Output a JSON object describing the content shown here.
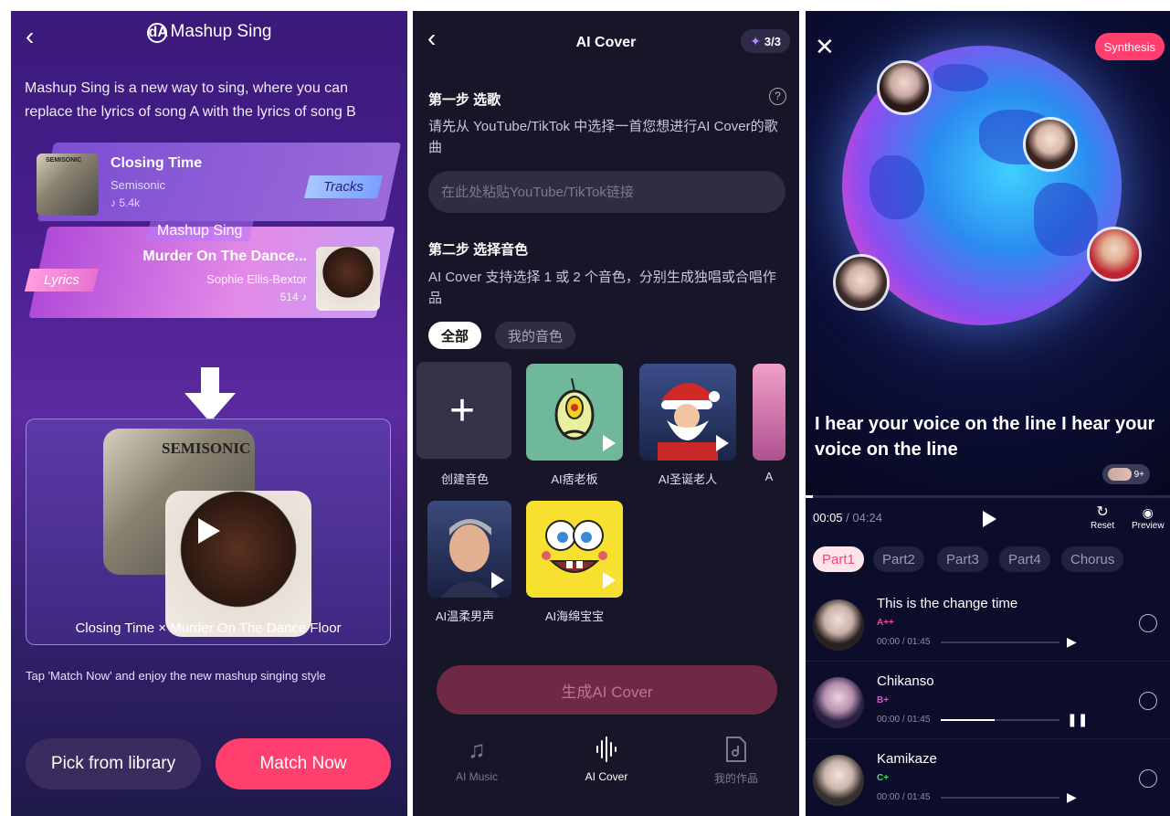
{
  "screen1": {
    "title": "Mashup Sing",
    "logo_text": "dA",
    "description": "Mashup Sing is a new way to sing, where you can replace the lyrics of song A with the lyrics of song B",
    "track_song": {
      "title": "Closing Time",
      "artist": "Semisonic",
      "plays": "5.4k",
      "album_text": "SEMISONIC"
    },
    "lyrics_song": {
      "title": "Murder On The Dance...",
      "artist": "Sophie Ellis-Bextor",
      "plays": "514"
    },
    "tracks_tag": "Tracks",
    "lyrics_tag": "Lyrics",
    "mashup_label": "Mashup Sing",
    "match_caption": "Closing Time × Murder On The Dance Floor",
    "hint": "Tap 'Match Now' and enjoy the new mashup singing style",
    "pick_button": "Pick from library",
    "match_button": "Match Now",
    "colors": {
      "accent": "#ff3f6e",
      "button_dark": "#3a2c5e"
    }
  },
  "screen2": {
    "title": "AI Cover",
    "counter": "3/3",
    "step1_title": "第一步 选歌",
    "step1_desc": "请先从 YouTube/TikTok 中选择一首您想进行AI Cover的歌曲",
    "link_placeholder": "在此处粘贴YouTube/TikTok链接",
    "step2_title": "第二步 选择音色",
    "step2_desc": "AI Cover 支持选择 1 或 2 个音色，分别生成独唱或合唱作品",
    "filter_all": "全部",
    "filter_mine": "我的音色",
    "voices": [
      {
        "label": "创建音色"
      },
      {
        "label": "AI痞老板"
      },
      {
        "label": "AI圣诞老人"
      },
      {
        "label": "A"
      },
      {
        "label": "AI温柔男声"
      },
      {
        "label": "AI海绵宝宝"
      }
    ],
    "generate_button": "生成AI Cover",
    "tabs": [
      {
        "label": "AI Music",
        "icon": "music-note-icon"
      },
      {
        "label": "AI Cover",
        "icon": "waveform-icon"
      },
      {
        "label": "我的作品",
        "icon": "my-works-icon"
      }
    ]
  },
  "screen3": {
    "synthesis_button": "Synthesis",
    "lyric": "I hear your voice on the line I hear your voice on the line",
    "more_count": "9+",
    "time_current": "00:05",
    "time_total": "/ 04:24",
    "progress": 0.02,
    "reset_label": "Reset",
    "preview_label": "Preview",
    "parts": [
      "Part1",
      "Part2",
      "Part3",
      "Part4",
      "Chorus"
    ],
    "tracks": [
      {
        "title": "This is the change time",
        "grade": "A++",
        "grade_color": "#ff3f9e",
        "time": "00:00",
        "duration": "/ 01:45",
        "progress": 0,
        "state": "play"
      },
      {
        "title": "Chikanso",
        "grade": "B+",
        "grade_color": "#e84ad8",
        "time": "00:00",
        "duration": "/ 01:45",
        "progress": 0.45,
        "state": "pause"
      },
      {
        "title": "Kamikaze",
        "grade": "C+",
        "grade_color": "#3ee06a",
        "time": "00:00",
        "duration": "/ 01:45",
        "progress": 0,
        "state": "play"
      }
    ]
  }
}
